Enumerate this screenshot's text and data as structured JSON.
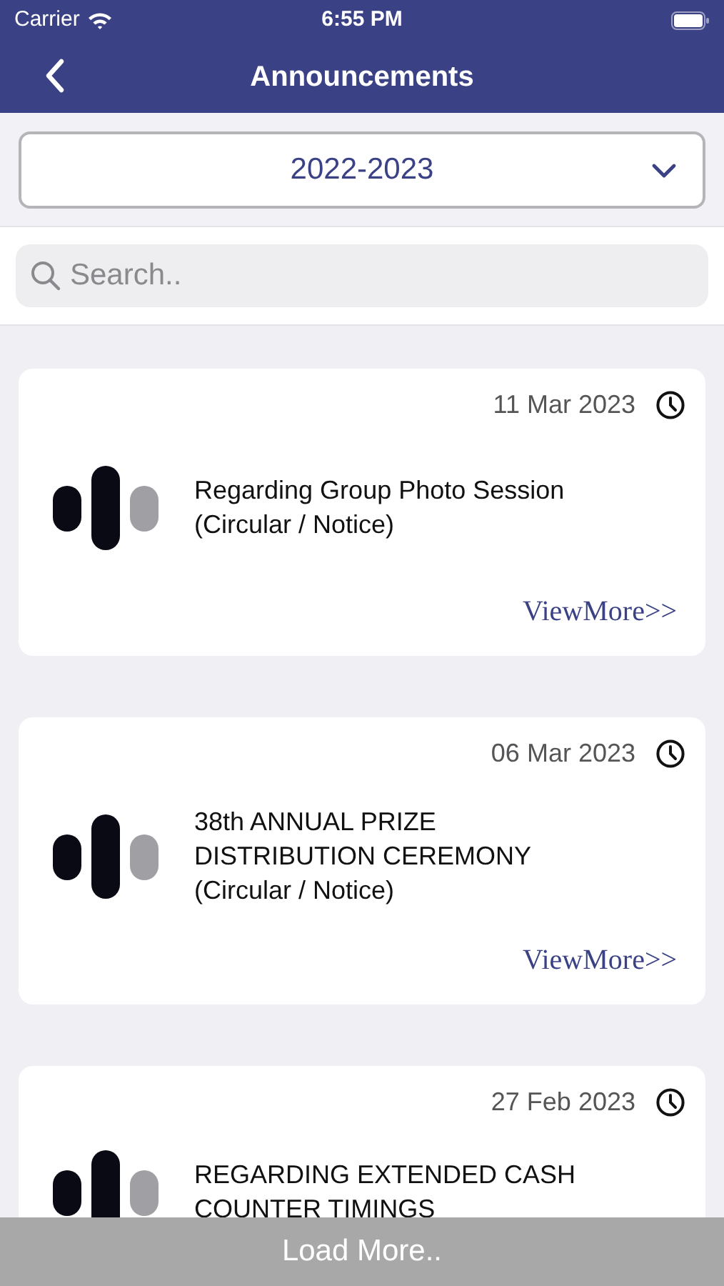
{
  "status_bar": {
    "carrier": "Carrier",
    "time": "6:55 PM"
  },
  "header": {
    "title": "Announcements"
  },
  "year_dropdown": {
    "value": "2022-2023"
  },
  "search": {
    "placeholder": "Search.."
  },
  "announcements": [
    {
      "date": "11 Mar 2023",
      "title": "Regarding Group Photo Session\n(Circular / Notice)",
      "link": "ViewMore>>"
    },
    {
      "date": "06 Mar 2023",
      "title": "38th ANNUAL PRIZE\nDISTRIBUTION CEREMONY\n(Circular / Notice)",
      "link": "ViewMore>>"
    },
    {
      "date": "27 Feb 2023",
      "title": "REGARDING EXTENDED CASH\nCOUNTER TIMINGS"
    }
  ],
  "load_more": "Load More.."
}
